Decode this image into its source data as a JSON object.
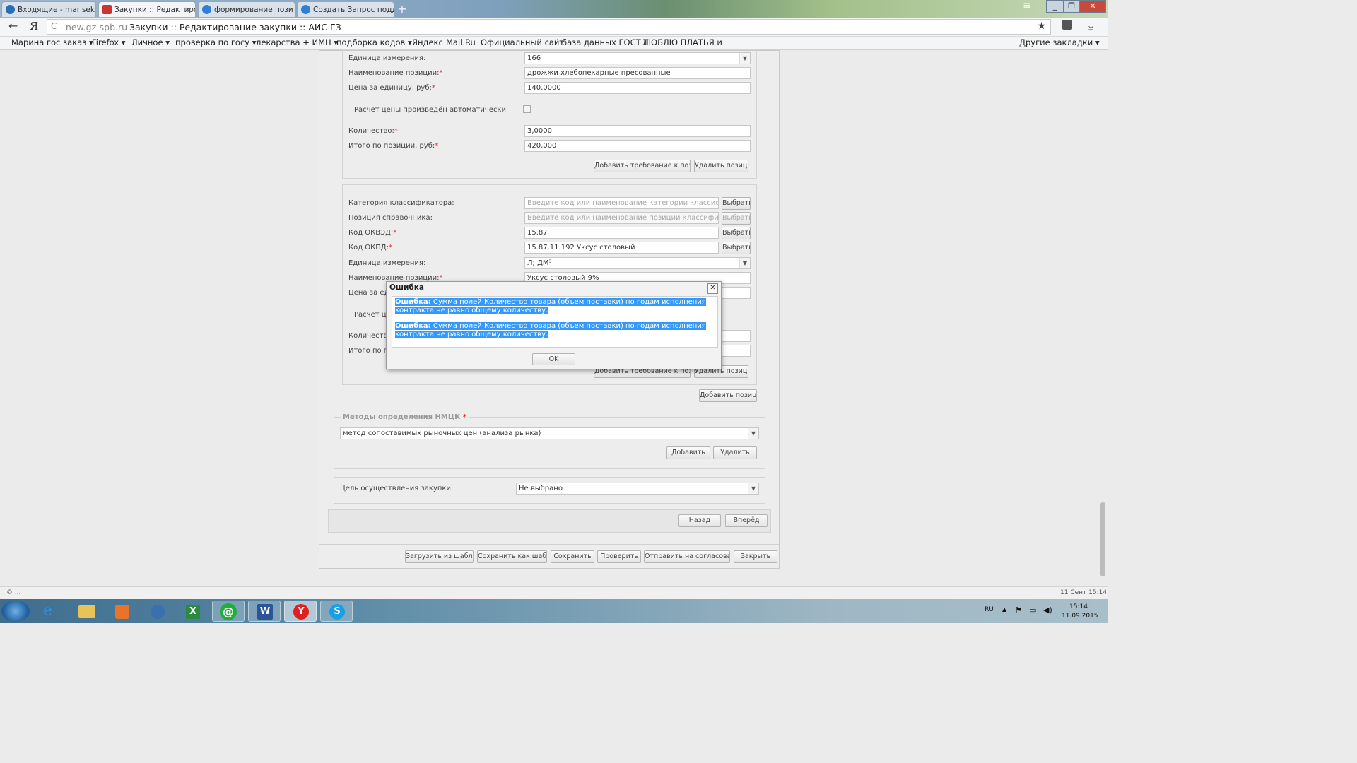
{
  "tabs": [
    {
      "label": "Входящие - marisek@",
      "active": false
    },
    {
      "label": "Закупки :: Редактиров",
      "active": true
    },
    {
      "label": "формирование пози",
      "active": false
    },
    {
      "label": "Создать Запрос подд",
      "active": false
    }
  ],
  "window_controls": {
    "menu": "≡",
    "minimize": "_",
    "maximize": "❐",
    "close": "✕"
  },
  "address": {
    "domain": "new.gz-spb.ru",
    "title": "Закупки :: Редактирование закупки :: АИС ГЗ",
    "back": "←",
    "y_logo": "Я",
    "reload": "C"
  },
  "bookmarks": [
    {
      "label": "Марина гос заказ ▾"
    },
    {
      "label": "Firefox ▾"
    },
    {
      "label": "Личное ▾"
    },
    {
      "label": "проверка по госу ▾"
    },
    {
      "label": "лекарства + ИМН ▾"
    },
    {
      "label": "подборка кодов ▾"
    },
    {
      "label": "Яндекс"
    },
    {
      "label": "Mail.Ru"
    },
    {
      "label": "Официальный сайт"
    },
    {
      "label": "база данных ГОСТ Т"
    },
    {
      "label": "ЛЮБЛЮ ПЛАТЬЯ и"
    }
  ],
  "other_bookmarks": "Другие закладки ▾",
  "position1": {
    "unit_label": "Единица измерения:",
    "unit_value": "166",
    "name_label": "Наименование позиции:",
    "name_value": "дрожжи хлебопекарные пресованные",
    "price_label": "Цена за единицу, руб:",
    "price_value": "140,0000",
    "auto_price_label": "Расчет цены произведён автоматически",
    "qty_label": "Количество:",
    "qty_value": "3,0000",
    "total_label": "Итого по позиции, руб:",
    "total_value": "420,000",
    "add_req_button": "Добавить требование к позиции",
    "delete_button": "Удалить позицию"
  },
  "position2": {
    "category_label": "Категория классификатора:",
    "category_placeholder": "Введите код или наименование категории классификатор",
    "ref_label": "Позиция справочника:",
    "ref_placeholder": "Введите код или наименование позиции классификатора",
    "okved_label": "Код ОКВЭД:",
    "okved_value": "15.87",
    "okpd_label": "Код ОКПД:",
    "okpd_value": "15.87.11.192 Уксус столовый",
    "unit_label": "Единица измерения:",
    "unit_value": "Л; ДМ³",
    "name_label": "Наименование позиции:",
    "name_value": "Уксус столовый 9%",
    "price_label": "Цена за еди",
    "auto_price_label": "Расчет це",
    "qty_label": "Количеств",
    "total_label": "Итого по по",
    "select_button": "Выбрать",
    "add_req_button": "Добавить требование к позиции",
    "delete_button": "Удалить позицию"
  },
  "add_position_button": "Добавить позицию",
  "nmck": {
    "legend": "Методы определения НМЦК",
    "value": "метод сопоставимых рыночных цен (анализа рынка)",
    "add_button": "Добавить",
    "delete_button": "Удалить"
  },
  "goal": {
    "label": "Цель осуществления закупки:",
    "value": "Не выбрано"
  },
  "nav": {
    "back": "Назад",
    "forward": "Вперёд"
  },
  "footer_buttons": [
    "Загрузить из шаблона",
    "Сохранить как шаблон",
    "Сохранить",
    "Проверить",
    "Отправить на согласование",
    "Закрыть"
  ],
  "dialog": {
    "title": "Ошибка",
    "close": "✕",
    "errors": [
      {
        "prefix": "Ошибка:",
        "text": " Сумма полей Количество товара (объем поставки) по годам исполнения контракта не равно общему количеству."
      },
      {
        "prefix": "Ошибка:",
        "text": " Сумма полей Количество товара (объем поставки) по годам исполнения контракта не равно общему количеству."
      }
    ],
    "ok": "OK"
  },
  "status": {
    "left": "© ...",
    "right": "11 Сент 15:14"
  },
  "tray": {
    "lang": "RU",
    "time": "15:14",
    "date": "11.09.2015"
  },
  "colors": {
    "selection": "#3399ff",
    "required": "#e03030"
  },
  "taskbar_icons": [
    "windows-start-icon",
    "internet-explorer-icon",
    "file-explorer-icon",
    "media-player-icon",
    "network-app-icon",
    "excel-icon",
    "mail-agent-icon",
    "word-icon",
    "yandex-browser-icon",
    "skype-icon"
  ]
}
